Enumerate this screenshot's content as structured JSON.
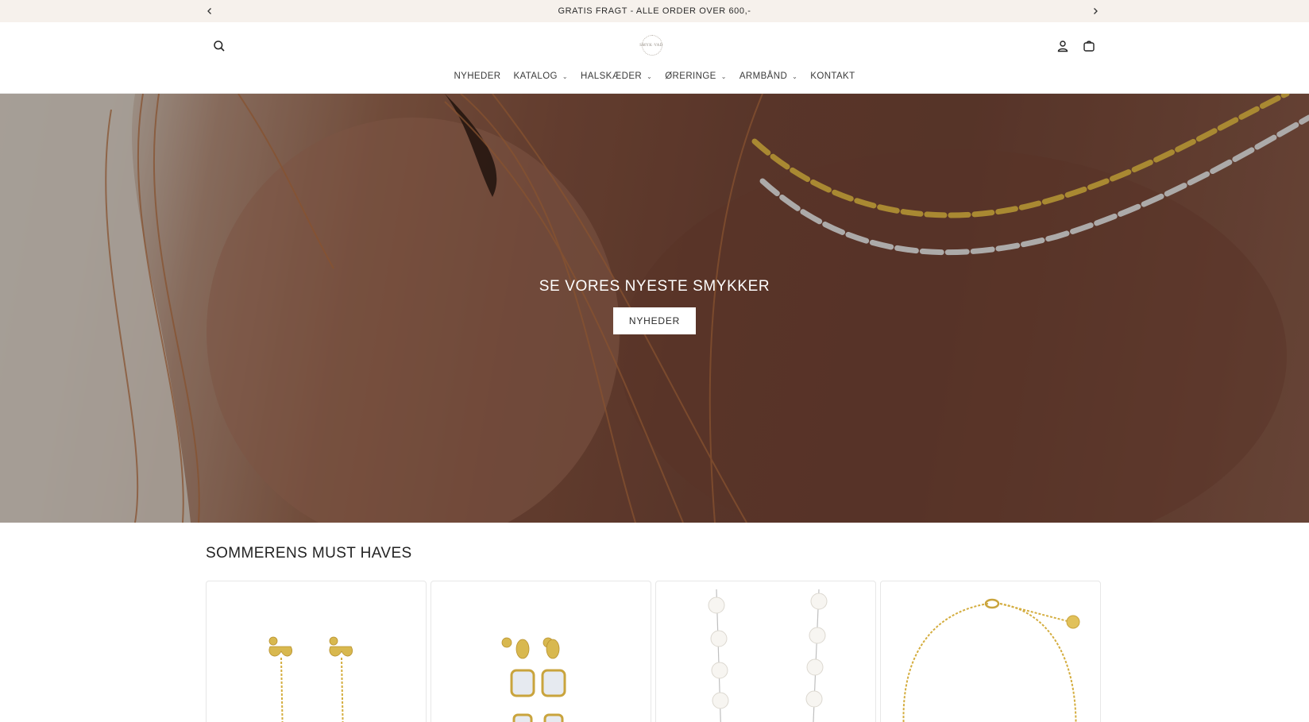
{
  "announcement": {
    "text": "GRATIS FRAGT - ALLE ORDER OVER 600,-",
    "prev_icon": "chevron-left-icon",
    "next_icon": "chevron-right-icon"
  },
  "header": {
    "logo_text": "SMYK·VAD",
    "icons": [
      "search-icon",
      "account-icon",
      "cart-icon"
    ]
  },
  "nav": {
    "items": [
      {
        "label": "NYHEDER",
        "dropdown": false
      },
      {
        "label": "KATALOG",
        "dropdown": true
      },
      {
        "label": "HALSKÆDER",
        "dropdown": true
      },
      {
        "label": "ØRERINGE",
        "dropdown": true
      },
      {
        "label": "ARMBÅND",
        "dropdown": true
      },
      {
        "label": "KONTAKT",
        "dropdown": false
      }
    ],
    "chevron": "⌄"
  },
  "hero": {
    "title": "SE VORES NYESTE SMYKKER",
    "button_label": "NYHEDER"
  },
  "section": {
    "title": "SOMMERENS MUST HAVES"
  },
  "products": [
    {
      "image": "gold-leaf-chain-earrings"
    },
    {
      "image": "gold-crystal-drop-earrings"
    },
    {
      "image": "pearl-necklace"
    },
    {
      "image": "gold-chain-bracelet"
    }
  ],
  "colors": {
    "announcement_bg": "#f6f1ec",
    "gold": "#d4ad3f",
    "silver": "#d8d8d8"
  }
}
